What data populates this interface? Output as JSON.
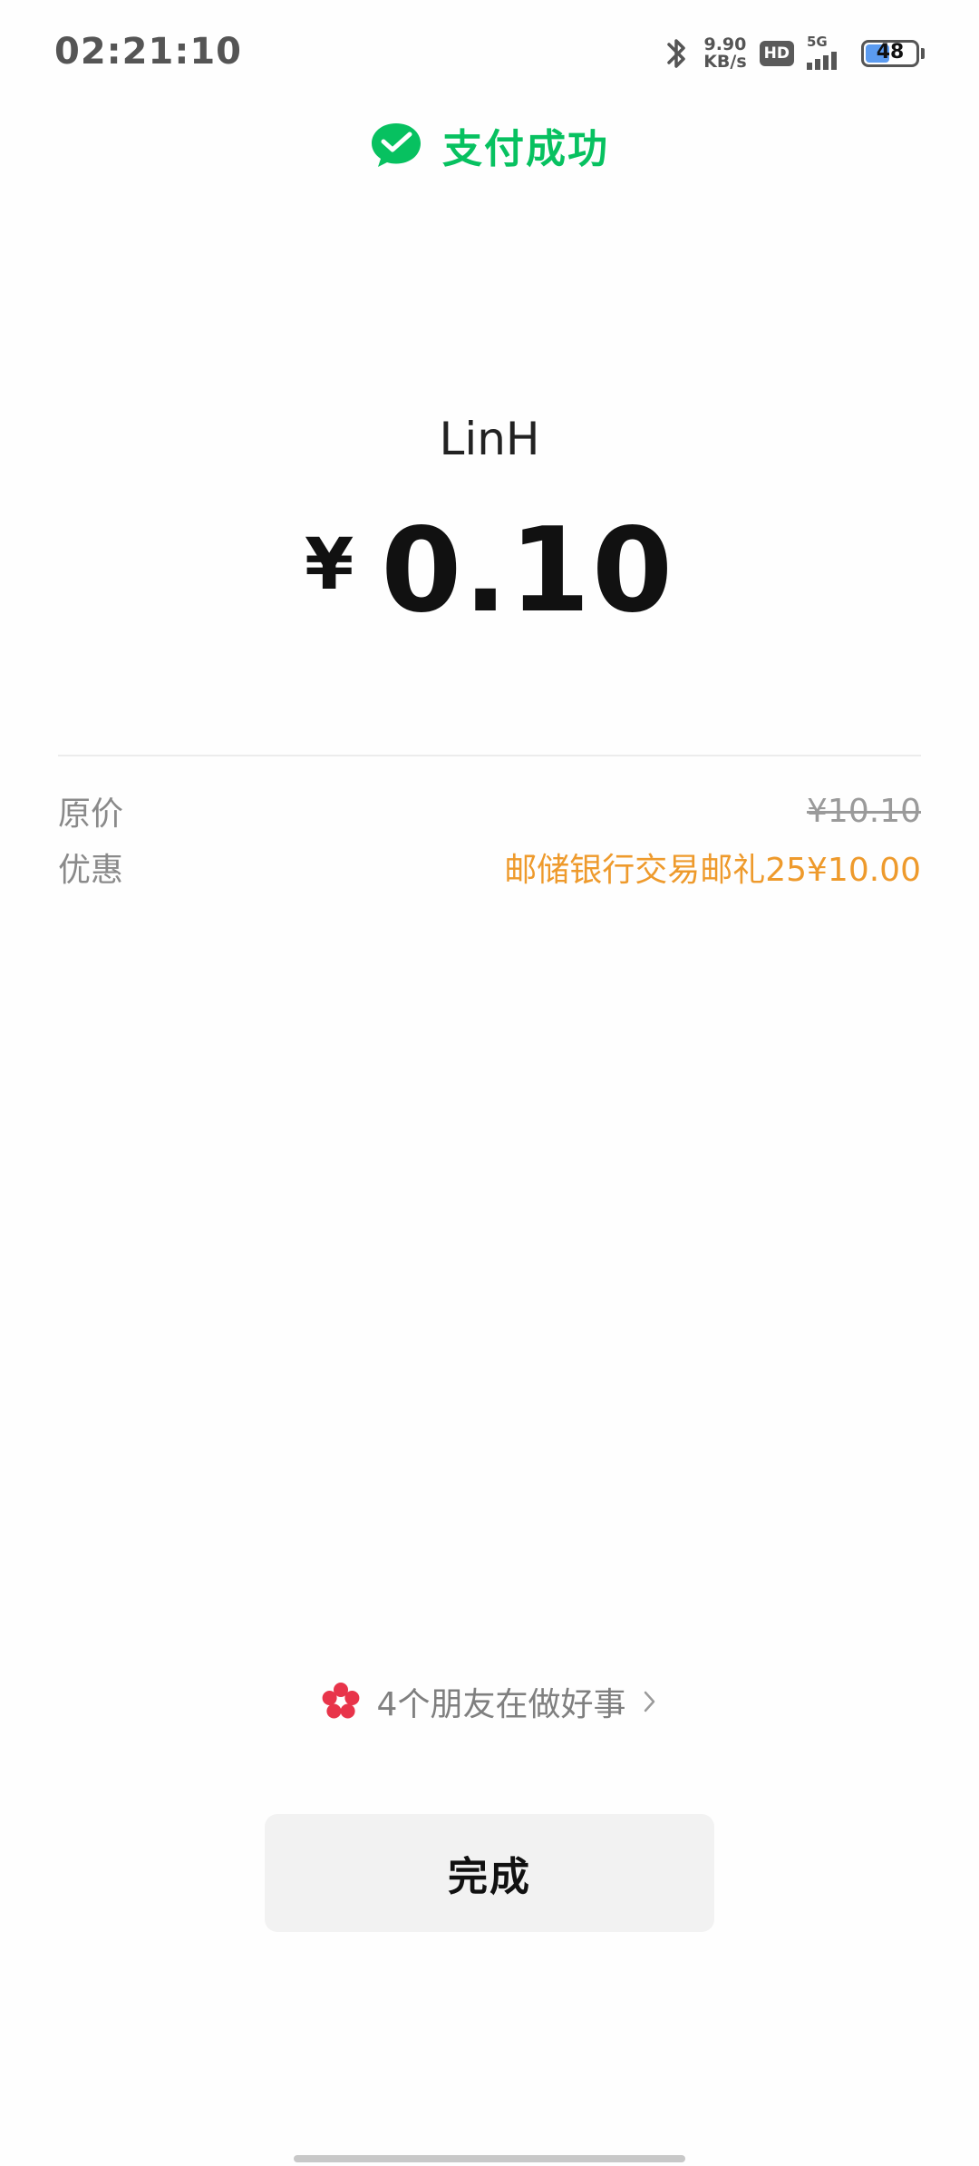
{
  "status_bar": {
    "time": "02:21:10",
    "net_speed_value": "9.90",
    "net_speed_unit": "KB/s",
    "hd_label": "HD",
    "network_label": "5G",
    "battery_level": "48",
    "battery_fill_color": "#5b9bf0"
  },
  "header": {
    "title": "支付成功",
    "icon": "wechat-pay-check-icon",
    "accent_color": "#07c160"
  },
  "payment": {
    "payee": "LinH",
    "currency_symbol": "¥",
    "amount": "0.10"
  },
  "details": {
    "original_price_label": "原价",
    "original_price_value": "¥10.10",
    "discount_label": "优惠",
    "discount_value": "邮储银行交易邮礼25¥10.00",
    "discount_color": "#ee9a2c"
  },
  "friends": {
    "text": "4个朋友在做好事",
    "icon": "red-flower-icon",
    "icon_color": "#e8344a"
  },
  "actions": {
    "done_label": "完成"
  }
}
